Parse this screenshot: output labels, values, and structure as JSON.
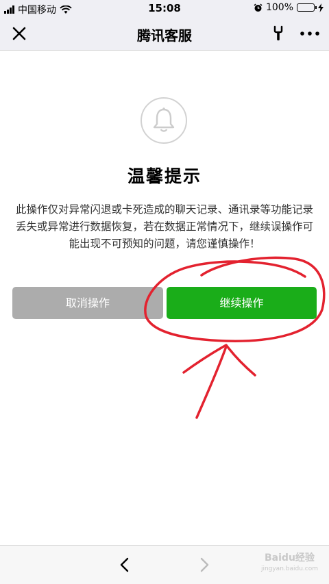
{
  "status_bar": {
    "carrier": "中国移动",
    "time": "15:08",
    "battery": "100%"
  },
  "nav": {
    "title": "腾讯客服"
  },
  "dialog": {
    "title": "温馨提示",
    "message": "此操作仅对异常闪退或卡死造成的聊天记录、通讯录等功能记录丢失或异常进行数据恢复，若在数据正常情况下，继续误操作可能出现不可预知的问题，请您谨慎操作！",
    "cancel_label": "取消操作",
    "continue_label": "继续操作"
  },
  "watermark": {
    "brand": "Baidu经验",
    "url": "jingyan.baidu.com"
  },
  "icons": {
    "close": "close-icon",
    "tool": "wrench-icon",
    "more": "more-icon",
    "bell": "bell-icon",
    "back": "chevron-left-icon",
    "forward": "chevron-right-icon"
  },
  "colors": {
    "primary_green": "#1aad19",
    "cancel_gray": "#acacac",
    "annotation_red": "#e3222f",
    "battery_green": "#4cd964"
  }
}
